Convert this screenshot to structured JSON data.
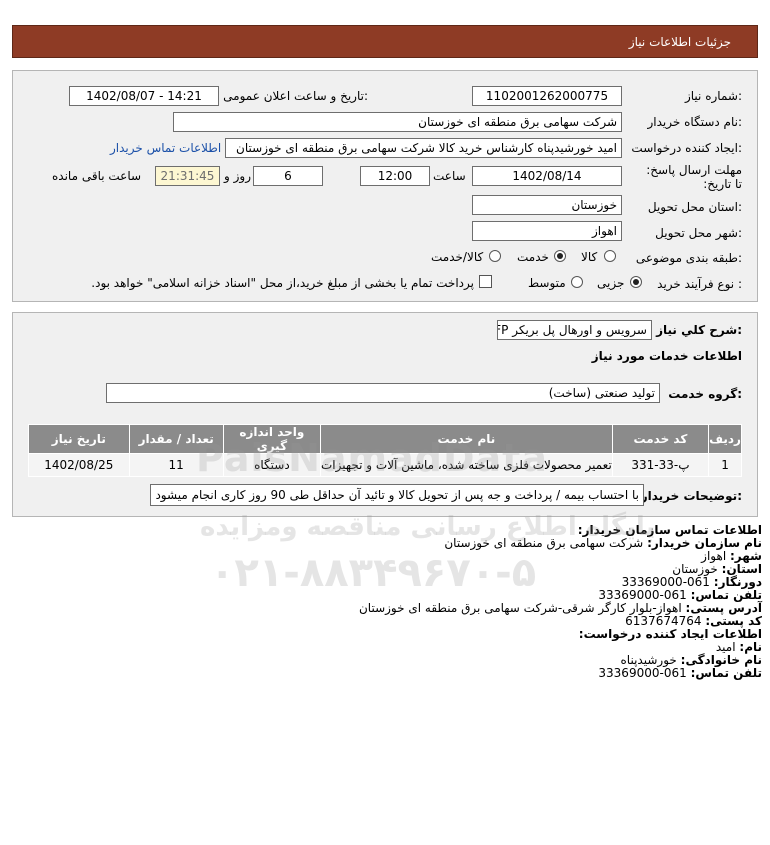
{
  "header": {
    "title": "جزئیات اطلاعات نیاز"
  },
  "form": {
    "need_number_label": "شماره نیاز:",
    "need_number": "1102001262000775",
    "announce_label": "تاریخ و ساعت اعلان عمومی:",
    "announce_value": "1402/08/07 - 14:21",
    "buyer_org_label": "نام دستگاه خریدار:",
    "buyer_org": "شرکت سهامی برق منطقه ای خوزستان",
    "creator_label": "ایجاد کننده درخواست:",
    "creator": "امید خورشیدپناه کارشناس خرید کالا شرکت سهامی برق منطقه ای خوزستان",
    "contact_link": "اطلاعات تماس خریدار",
    "deadline_label": "مهلت ارسال پاسخ: تا تاریخ:",
    "deadline_date": "1402/08/14",
    "time_label": "ساعت",
    "deadline_time": "12:00",
    "days_value": "6",
    "day_and_label": "روز و",
    "remaining_time": "21:31:45",
    "remaining_label": "ساعت باقی مانده",
    "province_label": "استان محل تحویل:",
    "province": "خوزستان",
    "city_label": "شهر محل تحویل:",
    "city": "اهواز",
    "category_label": "طبقه بندی موضوعی:",
    "category_options": [
      "کالا",
      "خدمت",
      "کالا/خدمت"
    ],
    "category_selected": "خدمت",
    "process_label": "نوع فرآیند خرید :",
    "process_options": [
      "جزیی",
      "متوسط"
    ],
    "process_selected": "جزیی",
    "treasury_text": "پرداخت تمام یا بخشی از مبلغ خرید،از محل \"اسناد خزانه اسلامی\" خواهد بود."
  },
  "need": {
    "summary_label": "شرح کلي نياز:",
    "summary": "سرویس و اورهال پل بریکر FP",
    "services_heading": "اطلاعات خدمات مورد نیاز",
    "group_label": "گروه خدمت:",
    "group_value": "تولید صنعتی (ساخت)",
    "table": {
      "headers": [
        "ردیف",
        "کد خدمت",
        "نام خدمت",
        "واحد اندازه گیری",
        "تعداد / مقدار",
        "تاریخ نیاز"
      ],
      "rows": [
        [
          "1",
          "پ-33-331",
          "تعمیر محصولات فلزی ساخته شده، ماشین آلات و تجهیزات",
          "دستگاه",
          "11",
          "1402/08/25"
        ]
      ]
    },
    "buyer_notes_label": "توضیحات خریدار:",
    "buyer_notes": "با احتساب بیمه / پرداخت و جه پس از تحویل کالا و تائید آن حداقل طی 90 روز کاری انجام میشود"
  },
  "contact": {
    "heading": "اطلاعات تماس سازمان خریدار:",
    "org_label": "نام سازمان خریدار:",
    "org": "شرکت سهامی برق منطقه ای خوزستان",
    "city_label": "شهر:",
    "city": "اهواز",
    "province_label": "استان:",
    "province": "خوزستان",
    "fax_label": "دورنگار:",
    "fax": "061-33369000",
    "phone_label": "تلفن تماس:",
    "phone": "061-33369000",
    "address_label": "آدرس پستی:",
    "address": "اهواز-بلوار کارگر شرقی-شرکت سهامی برق منطقه ای خوزستان",
    "postal_label": "کد پستی:",
    "postal": "6137674764",
    "creator_heading": "اطلاعات ایجاد کننده درخواست:",
    "name_label": "نام:",
    "name": "امید",
    "family_label": "نام خانوادگی:",
    "family": "خورشیدپناه",
    "creator_phone_label": "تلفن تماس:",
    "creator_phone": "061-33369000"
  },
  "watermark": {
    "brand": "PaisNamadData",
    "tagline": "پایگاه اطلاع رسانی مناقصه ومزایده",
    "phone": "۰۲۱-۸۸۳۴۹۶۷۰-۵"
  }
}
